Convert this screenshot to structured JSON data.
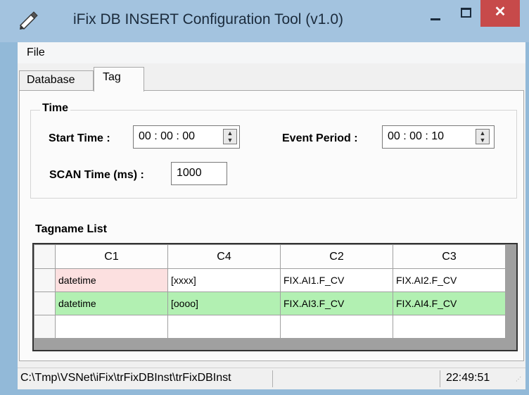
{
  "window": {
    "title": "iFix DB INSERT Configuration Tool (v1.0)",
    "close_symbol": "✕"
  },
  "menu": {
    "file": "File"
  },
  "tabs": {
    "database": "Database",
    "tag": "Tag"
  },
  "time_group": {
    "title": "Time",
    "start_time_label": "Start Time :",
    "start_time_value": "00 : 00 : 00",
    "event_period_label": "Event Period :",
    "event_period_value": "00 : 00 : 10",
    "scan_time_label": "SCAN Time  (ms) :",
    "scan_time_value": "1000"
  },
  "tagname_list": {
    "title": "Tagname List",
    "columns": [
      "C1",
      "C4",
      "C2",
      "C3"
    ],
    "rows": [
      [
        "datetime",
        "[xxxx]",
        "FIX.AI1.F_CV",
        "FIX.AI2.F_CV"
      ],
      [
        "datetime",
        "[oooo]",
        "FIX.AI3.F_CV",
        "FIX.AI4.F_CV"
      ],
      [
        "",
        "",
        "",
        ""
      ]
    ]
  },
  "statusbar": {
    "path": "C:\\Tmp\\VSNet\\iFix\\trFixDBInst\\trFixDBInst",
    "time": "22:49:51"
  },
  "colors": {
    "title_bar": "#a3c3df",
    "close_button": "#c74a4a",
    "row_highlight_red": "#fce0e0",
    "row_highlight_green": "#b2f0b2"
  },
  "icons": {
    "app": "app-tool-icon",
    "spin": "spin-updown-icon",
    "grip": "resize-grip-icon"
  }
}
